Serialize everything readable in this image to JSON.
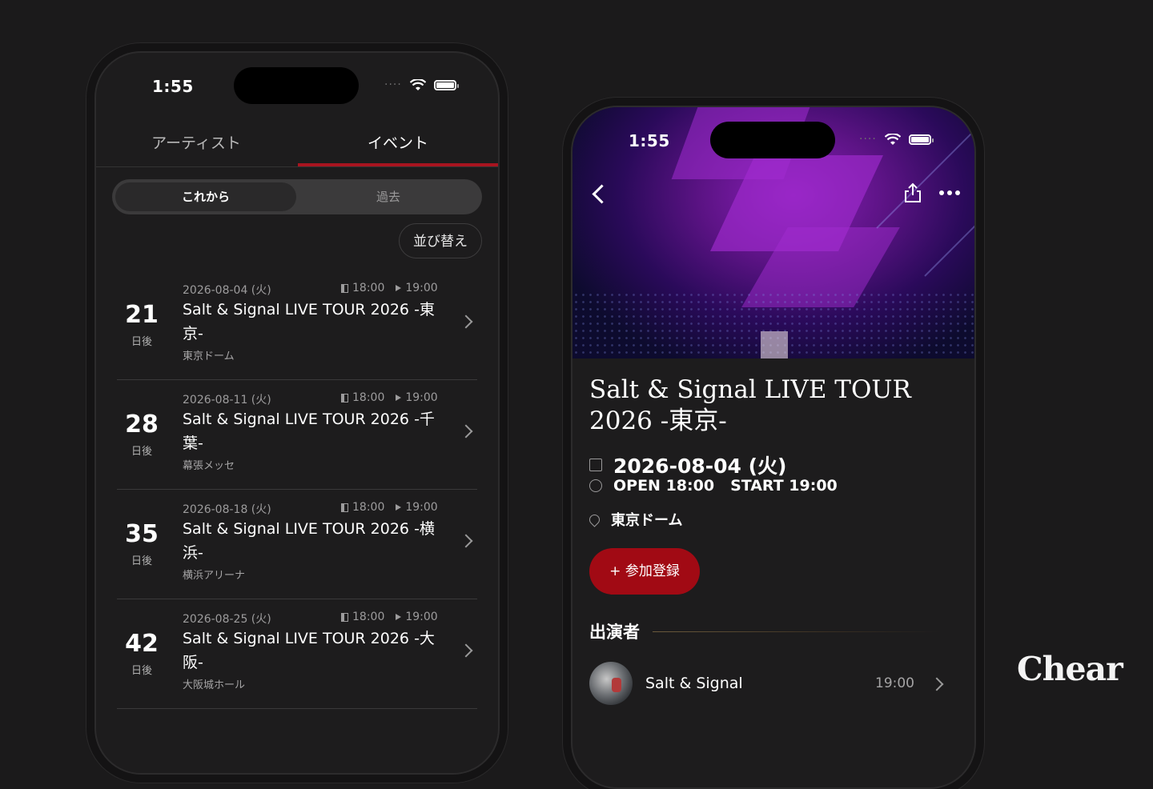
{
  "left_phone": {
    "status": {
      "time": "1:55"
    },
    "tabs": [
      {
        "label": "アーティスト"
      },
      {
        "label": "イベント"
      }
    ],
    "segment": {
      "upcoming": "これから",
      "past": "過去"
    },
    "sort_label": "並び替え",
    "events": [
      {
        "days": "21",
        "days_unit": "日後",
        "date": "2026-08-04 (火)",
        "open": "18:00",
        "start": "19:00",
        "title": "Salt & Signal LIVE TOUR 2026 -東京-",
        "venue": "東京ドーム"
      },
      {
        "days": "28",
        "days_unit": "日後",
        "date": "2026-08-11 (火)",
        "open": "18:00",
        "start": "19:00",
        "title": "Salt & Signal LIVE TOUR 2026 -千葉-",
        "venue": "幕張メッセ"
      },
      {
        "days": "35",
        "days_unit": "日後",
        "date": "2026-08-18 (火)",
        "open": "18:00",
        "start": "19:00",
        "title": "Salt & Signal LIVE TOUR 2026 -横浜-",
        "venue": "横浜アリーナ"
      },
      {
        "days": "42",
        "days_unit": "日後",
        "date": "2026-08-25 (火)",
        "open": "18:00",
        "start": "19:00",
        "title": "Salt & Signal LIVE TOUR 2026 -大阪-",
        "venue": "大阪城ホール"
      }
    ]
  },
  "right_phone": {
    "status": {
      "time": "1:55"
    },
    "title": "Salt & Signal LIVE TOUR 2026 -東京-",
    "date": "2026-08-04 (火)",
    "open": "OPEN 18:00",
    "start": "START 19:00",
    "venue": "東京ドーム",
    "join_label": "+ 参加登録",
    "performers_heading": "出演者",
    "performers": [
      {
        "name": "Salt & Signal",
        "time": "19:00"
      }
    ]
  },
  "brand": "Chear",
  "colors": {
    "accent": "#a8141f",
    "button": "#a10a14",
    "background": "#1b1a1b"
  }
}
